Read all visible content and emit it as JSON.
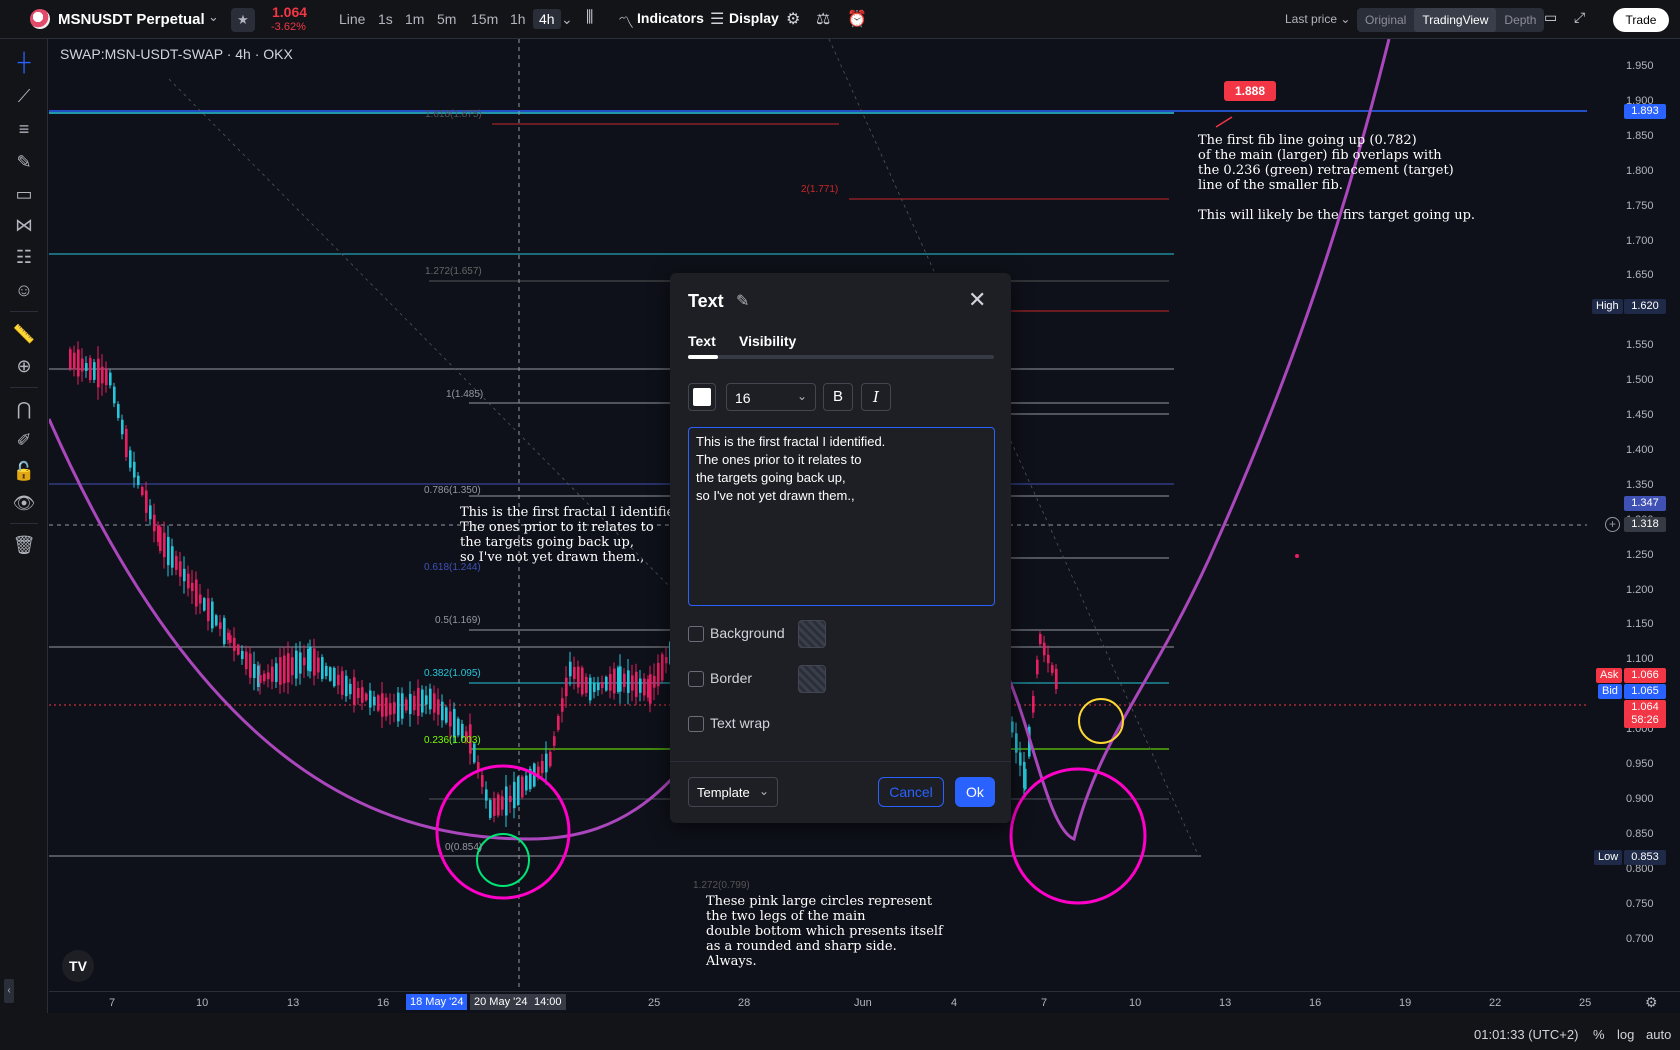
{
  "header": {
    "symbol": "MSNUSDT Perpetual",
    "price": "1.064",
    "change": "-3.62%",
    "timeframes": [
      "Line",
      "1s",
      "1m",
      "5m",
      "15m",
      "1h",
      "4h"
    ],
    "active_timeframe": "4h",
    "indicators_label": "Indicators",
    "display_label": "Display",
    "last_price_label": "Last price",
    "views": [
      "Original",
      "TradingView",
      "Depth"
    ],
    "active_view": "TradingView",
    "trade_label": "Trade"
  },
  "chart": {
    "title": "SWAP:MSN-USDT-SWAP · 4h · OKX",
    "price_axis": [
      "1.950",
      "1.900",
      "1.850",
      "1.800",
      "1.750",
      "1.700",
      "1.650",
      "1.600",
      "1.550",
      "1.500",
      "1.450",
      "1.400",
      "1.350",
      "1.300",
      "1.250",
      "1.200",
      "1.150",
      "1.100",
      "1.050",
      "1.000",
      "0.950",
      "0.900",
      "0.850",
      "0.800",
      "0.750",
      "0.700"
    ],
    "tags": {
      "top_line": "1.893",
      "high_label": "High",
      "high": "1.620",
      "level_1347": "1.347",
      "crosshair": "1.318",
      "ask_label": "Ask",
      "ask": "1.066",
      "bid_label": "Bid",
      "bid": "1.065",
      "last": "1.064",
      "countdown": "58:26",
      "low_label": "Low",
      "low": "0.853",
      "callout": "1.888"
    },
    "time_axis": [
      "7",
      "10",
      "13",
      "16",
      "18 May '24",
      "20 May '24",
      "14:00",
      "25",
      "28",
      "Jun",
      "4",
      "7",
      "10",
      "13",
      "16",
      "19",
      "22",
      "25"
    ],
    "fib_labels": {
      "f1618": "1.618(1.875)",
      "f2": "2(1.771)",
      "f1272": "1.272(1.657)",
      "f1": "1(1.485)",
      "f786": "0.786(1.350)",
      "f618": "0.618(1.244)",
      "f5": "0.5(1.169)",
      "f382": "0.382(1.095)",
      "f236": "0.236(1.003)",
      "f0": "0(0.854)",
      "fneg": "1.272(0.799)"
    },
    "annotations": {
      "fractal": "This is the first fractal I identified.\nThe ones prior to it relates to\nthe targets going back up,\nso I've not yet drawn them.,",
      "fib_note": "The first fib line going up (0.782)\nof the main (larger) fib overlaps with\nthe 0.236 (green) retracement (target)\nline of the smaller fib.\n\nThis will likely be the firs target going up.",
      "circles_note": "These pink large circles represent\nthe two legs of the main\ndouble bottom which presents itself\nas a rounded and sharp side.\nAlways."
    }
  },
  "modal": {
    "title": "Text",
    "tabs": [
      "Text",
      "Visibility"
    ],
    "font_size": "16",
    "bold": "B",
    "italic": "I",
    "text_value": "This is the first fractal I identified.\nThe ones prior to it relates to\nthe targets going back up,\nso I've not yet drawn them.,",
    "background_label": "Background",
    "border_label": "Border",
    "wrap_label": "Text wrap",
    "template_label": "Template",
    "cancel_label": "Cancel",
    "ok_label": "Ok"
  },
  "footer": {
    "clock": "01:01:33 (UTC+2)",
    "percent": "%",
    "log": "log",
    "auto": "auto"
  },
  "colors": {
    "bull": "#26c6da",
    "bear": "#e91e63",
    "accent": "#2962ff",
    "arc": "#ab47bc",
    "circle": "#ff00c8"
  }
}
